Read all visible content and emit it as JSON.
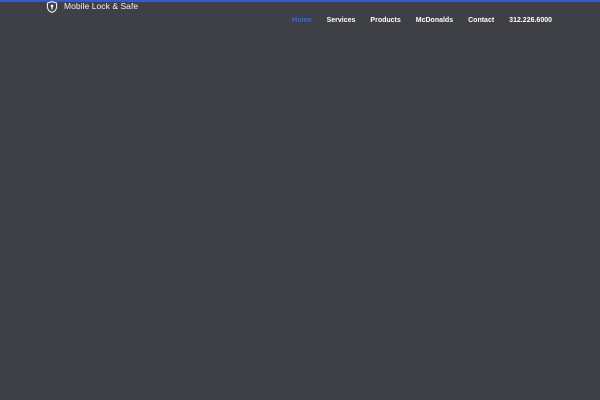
{
  "header": {
    "logo_text": "Mobile Lock & Safe",
    "logo_icon": "shield-lock-icon",
    "nav_items": [
      {
        "label": "Home",
        "active": true
      },
      {
        "label": "Services",
        "active": false
      },
      {
        "label": "Products",
        "active": false
      },
      {
        "label": "McDonalds",
        "active": false
      },
      {
        "label": "Contact",
        "active": false
      }
    ],
    "phone": "312.226.6000"
  },
  "colors": {
    "background": "#3f4045",
    "accent": "#2f6bf0",
    "top_bar": "#2f5bd8",
    "text": "#ffffff"
  }
}
